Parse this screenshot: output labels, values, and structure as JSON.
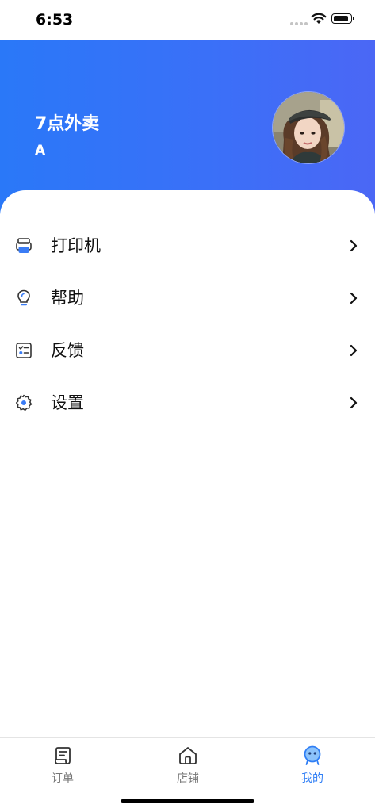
{
  "status_bar": {
    "time": "6:53"
  },
  "profile": {
    "shop_name": "7点外卖",
    "user_name": "A"
  },
  "menu": [
    {
      "label": "打印机",
      "icon": "printer-icon"
    },
    {
      "label": "帮助",
      "icon": "lightbulb-icon"
    },
    {
      "label": "反馈",
      "icon": "feedback-checklist-icon"
    },
    {
      "label": "设置",
      "icon": "gear-icon"
    }
  ],
  "tabs": [
    {
      "label": "订单",
      "icon": "order-receipt-icon",
      "active": false
    },
    {
      "label": "店铺",
      "icon": "store-home-icon",
      "active": false
    },
    {
      "label": "我的",
      "icon": "profile-mascot-icon",
      "active": true
    }
  ],
  "colors": {
    "header_gradient_start": "#2a78f8",
    "header_gradient_end": "#4b67f5",
    "active_tab": "#2f7ef5",
    "icon_blue": "#3a7cf5"
  }
}
